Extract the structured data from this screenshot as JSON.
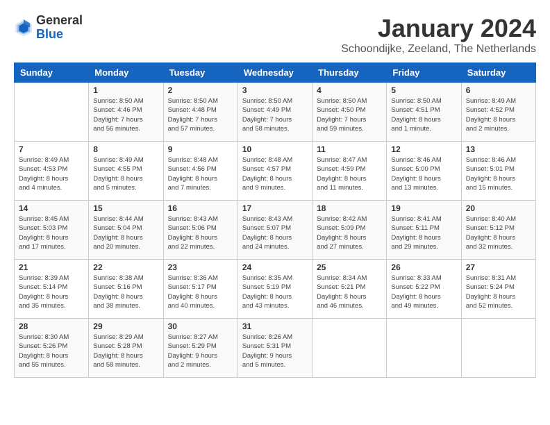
{
  "logo": {
    "general": "General",
    "blue": "Blue"
  },
  "header": {
    "title": "January 2024",
    "subtitle": "Schoondijke, Zeeland, The Netherlands"
  },
  "weekdays": [
    "Sunday",
    "Monday",
    "Tuesday",
    "Wednesday",
    "Thursday",
    "Friday",
    "Saturday"
  ],
  "weeks": [
    [
      {
        "day": "",
        "info": ""
      },
      {
        "day": "1",
        "info": "Sunrise: 8:50 AM\nSunset: 4:46 PM\nDaylight: 7 hours\nand 56 minutes."
      },
      {
        "day": "2",
        "info": "Sunrise: 8:50 AM\nSunset: 4:48 PM\nDaylight: 7 hours\nand 57 minutes."
      },
      {
        "day": "3",
        "info": "Sunrise: 8:50 AM\nSunset: 4:49 PM\nDaylight: 7 hours\nand 58 minutes."
      },
      {
        "day": "4",
        "info": "Sunrise: 8:50 AM\nSunset: 4:50 PM\nDaylight: 7 hours\nand 59 minutes."
      },
      {
        "day": "5",
        "info": "Sunrise: 8:50 AM\nSunset: 4:51 PM\nDaylight: 8 hours\nand 1 minute."
      },
      {
        "day": "6",
        "info": "Sunrise: 8:49 AM\nSunset: 4:52 PM\nDaylight: 8 hours\nand 2 minutes."
      }
    ],
    [
      {
        "day": "7",
        "info": "Sunrise: 8:49 AM\nSunset: 4:53 PM\nDaylight: 8 hours\nand 4 minutes."
      },
      {
        "day": "8",
        "info": "Sunrise: 8:49 AM\nSunset: 4:55 PM\nDaylight: 8 hours\nand 5 minutes."
      },
      {
        "day": "9",
        "info": "Sunrise: 8:48 AM\nSunset: 4:56 PM\nDaylight: 8 hours\nand 7 minutes."
      },
      {
        "day": "10",
        "info": "Sunrise: 8:48 AM\nSunset: 4:57 PM\nDaylight: 8 hours\nand 9 minutes."
      },
      {
        "day": "11",
        "info": "Sunrise: 8:47 AM\nSunset: 4:59 PM\nDaylight: 8 hours\nand 11 minutes."
      },
      {
        "day": "12",
        "info": "Sunrise: 8:46 AM\nSunset: 5:00 PM\nDaylight: 8 hours\nand 13 minutes."
      },
      {
        "day": "13",
        "info": "Sunrise: 8:46 AM\nSunset: 5:01 PM\nDaylight: 8 hours\nand 15 minutes."
      }
    ],
    [
      {
        "day": "14",
        "info": "Sunrise: 8:45 AM\nSunset: 5:03 PM\nDaylight: 8 hours\nand 17 minutes."
      },
      {
        "day": "15",
        "info": "Sunrise: 8:44 AM\nSunset: 5:04 PM\nDaylight: 8 hours\nand 20 minutes."
      },
      {
        "day": "16",
        "info": "Sunrise: 8:43 AM\nSunset: 5:06 PM\nDaylight: 8 hours\nand 22 minutes."
      },
      {
        "day": "17",
        "info": "Sunrise: 8:43 AM\nSunset: 5:07 PM\nDaylight: 8 hours\nand 24 minutes."
      },
      {
        "day": "18",
        "info": "Sunrise: 8:42 AM\nSunset: 5:09 PM\nDaylight: 8 hours\nand 27 minutes."
      },
      {
        "day": "19",
        "info": "Sunrise: 8:41 AM\nSunset: 5:11 PM\nDaylight: 8 hours\nand 29 minutes."
      },
      {
        "day": "20",
        "info": "Sunrise: 8:40 AM\nSunset: 5:12 PM\nDaylight: 8 hours\nand 32 minutes."
      }
    ],
    [
      {
        "day": "21",
        "info": "Sunrise: 8:39 AM\nSunset: 5:14 PM\nDaylight: 8 hours\nand 35 minutes."
      },
      {
        "day": "22",
        "info": "Sunrise: 8:38 AM\nSunset: 5:16 PM\nDaylight: 8 hours\nand 38 minutes."
      },
      {
        "day": "23",
        "info": "Sunrise: 8:36 AM\nSunset: 5:17 PM\nDaylight: 8 hours\nand 40 minutes."
      },
      {
        "day": "24",
        "info": "Sunrise: 8:35 AM\nSunset: 5:19 PM\nDaylight: 8 hours\nand 43 minutes."
      },
      {
        "day": "25",
        "info": "Sunrise: 8:34 AM\nSunset: 5:21 PM\nDaylight: 8 hours\nand 46 minutes."
      },
      {
        "day": "26",
        "info": "Sunrise: 8:33 AM\nSunset: 5:22 PM\nDaylight: 8 hours\nand 49 minutes."
      },
      {
        "day": "27",
        "info": "Sunrise: 8:31 AM\nSunset: 5:24 PM\nDaylight: 8 hours\nand 52 minutes."
      }
    ],
    [
      {
        "day": "28",
        "info": "Sunrise: 8:30 AM\nSunset: 5:26 PM\nDaylight: 8 hours\nand 55 minutes."
      },
      {
        "day": "29",
        "info": "Sunrise: 8:29 AM\nSunset: 5:28 PM\nDaylight: 8 hours\nand 58 minutes."
      },
      {
        "day": "30",
        "info": "Sunrise: 8:27 AM\nSunset: 5:29 PM\nDaylight: 9 hours\nand 2 minutes."
      },
      {
        "day": "31",
        "info": "Sunrise: 8:26 AM\nSunset: 5:31 PM\nDaylight: 9 hours\nand 5 minutes."
      },
      {
        "day": "",
        "info": ""
      },
      {
        "day": "",
        "info": ""
      },
      {
        "day": "",
        "info": ""
      }
    ]
  ]
}
